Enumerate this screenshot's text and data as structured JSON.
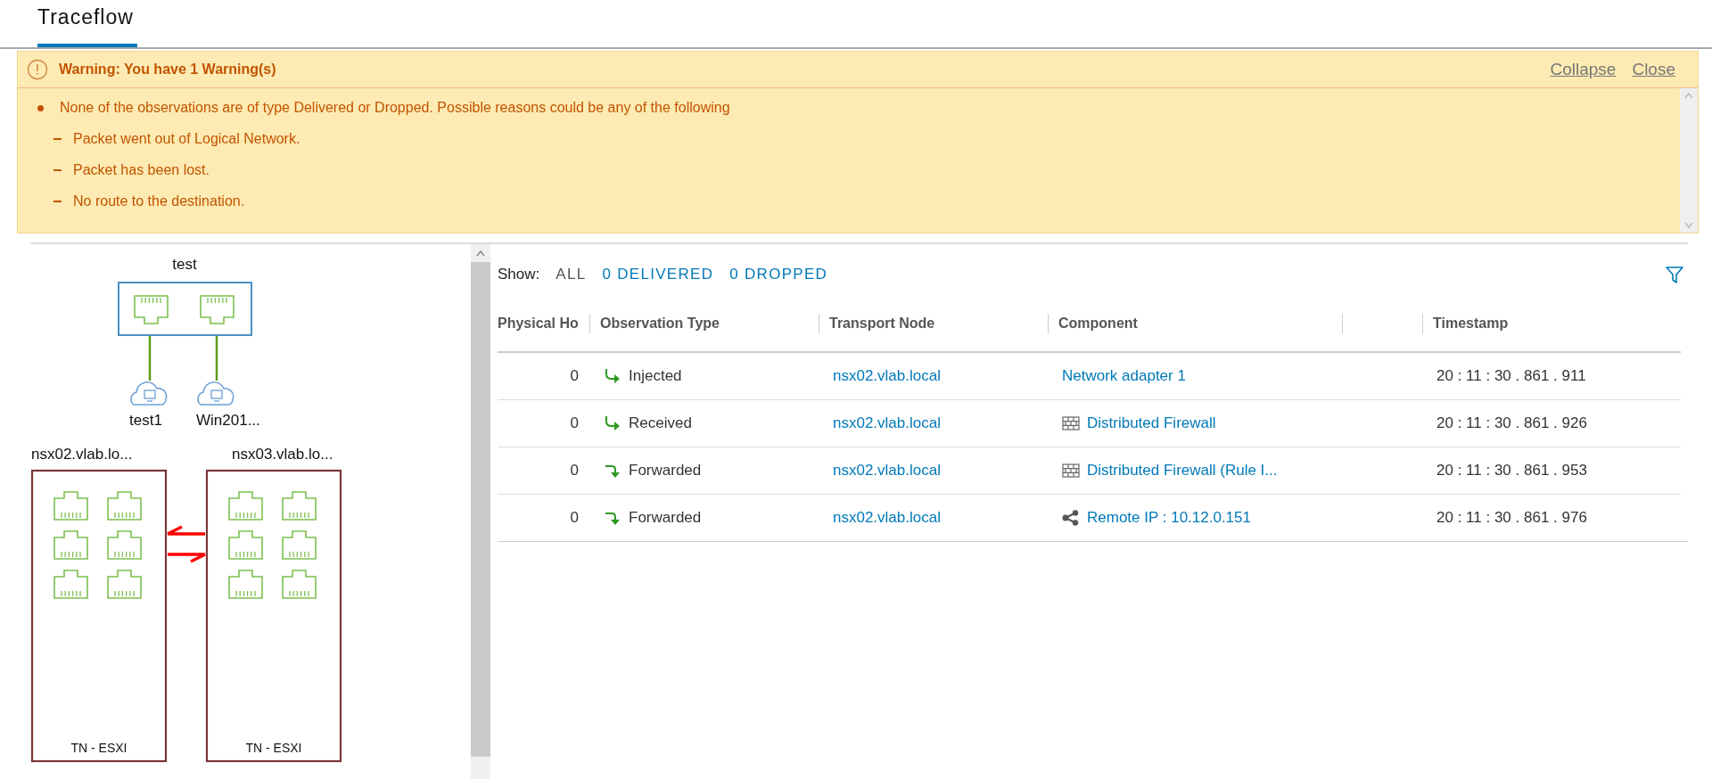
{
  "header": {
    "tabs": [
      {
        "label": "Traceflow",
        "selected": true
      }
    ]
  },
  "warning": {
    "title": "Warning: You have 1 Warning(s)",
    "actions": [
      "Collapse",
      "Close"
    ],
    "message": "None of the observations are of type Delivered or Dropped. Possible reasons could be any of the following",
    "reasons": [
      "Packet went out of Logical Network.",
      "Packet has been lost.",
      "No route to the destination."
    ]
  },
  "topology": {
    "segment": {
      "label": "test"
    },
    "vms": [
      {
        "label": "test1"
      },
      {
        "label": "Win201..."
      }
    ],
    "hosts": [
      {
        "label": "nsx02.vlab.lo...",
        "type_label": "TN - ESXI"
      },
      {
        "label": "nsx03.vlab.lo...",
        "type_label": "TN - ESXI"
      }
    ]
  },
  "filters": {
    "label": "Show:",
    "options": [
      {
        "label": "ALL",
        "selected": true
      },
      {
        "label": "0 DELIVERED",
        "selected": false
      },
      {
        "label": "0 DROPPED",
        "selected": false
      }
    ]
  },
  "table": {
    "columns": [
      "Physical Ho",
      "Observation Type",
      "Transport Node",
      "Component",
      "Timestamp"
    ],
    "rows": [
      {
        "physical_host": "0",
        "observation": {
          "label": "Injected",
          "kind": "turn-right"
        },
        "transport_node": "nsx02.vlab.local",
        "component": {
          "label": "Network adapter 1"
        },
        "timestamp": "20 : 11 : 30 . 861 . 911"
      },
      {
        "physical_host": "0",
        "observation": {
          "label": "Received",
          "kind": "turn-right"
        },
        "transport_node": "nsx02.vlab.local",
        "component": {
          "label": "Distributed Firewall",
          "kind": "firewall"
        },
        "timestamp": "20 : 11 : 30 . 861 . 926"
      },
      {
        "physical_host": "0",
        "observation": {
          "label": "Forwarded",
          "kind": "turn-down"
        },
        "transport_node": "nsx02.vlab.local",
        "component": {
          "label": "Distributed Firewall (Rule I...",
          "kind": "firewall"
        },
        "timestamp": "20 : 11 : 30 . 861 . 953"
      },
      {
        "physical_host": "0",
        "observation": {
          "label": "Forwarded",
          "kind": "turn-down"
        },
        "transport_node": "nsx02.vlab.local",
        "component": {
          "label": "Remote IP : 10.12.0.151",
          "kind": "remote"
        },
        "timestamp": "20 : 11 : 30 . 861 . 976"
      }
    ]
  }
}
